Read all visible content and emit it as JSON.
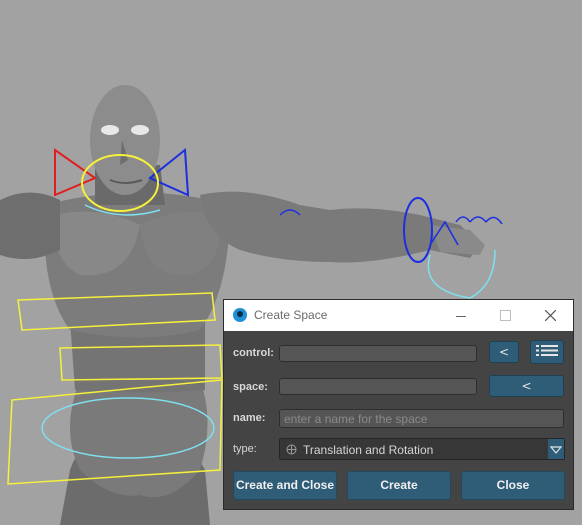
{
  "window": {
    "title": "Create Space",
    "controls": [
      "minimize-icon",
      "maximize-icon",
      "close-icon"
    ]
  },
  "form": {
    "control_label": "control:",
    "control_value": "",
    "control_pick_label": "<",
    "control_list_icon": "list-icon",
    "space_label": "space:",
    "space_value": "",
    "space_pick_label": "<",
    "name_label": "name:",
    "name_placeholder": "enter a name for the space",
    "type_label": "type:",
    "type_value": "Translation and Rotation",
    "type_icon": "globe-icon"
  },
  "actions": {
    "create_and_close": "Create and Close",
    "create": "Create",
    "close": "Close"
  },
  "colors": {
    "viewport_bg": "#a2a2a2",
    "dialog_bg": "#444444",
    "button_accent": "#2f5c76",
    "control_yellow": "#f5f03c",
    "control_red": "#e02020",
    "control_blue": "#1b2ee0",
    "control_cyan": "#7ee0f0"
  }
}
